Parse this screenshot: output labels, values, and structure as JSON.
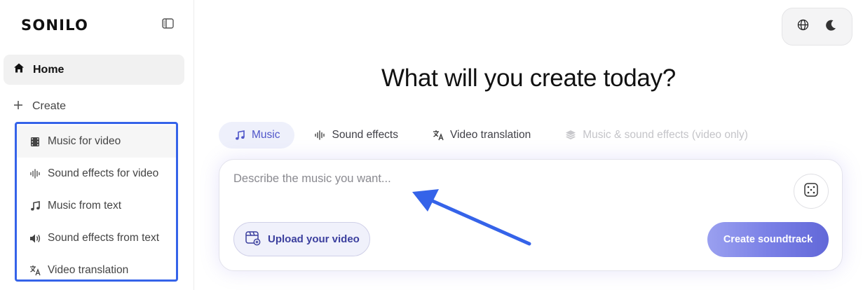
{
  "sidebar": {
    "logo": "SONILO",
    "home_label": "Home",
    "create_label": "Create",
    "create_items": [
      {
        "label": "Music for video",
        "icon": "film-icon"
      },
      {
        "label": "Sound effects for video",
        "icon": "waveform-icon"
      },
      {
        "label": "Music from text",
        "icon": "music-note-icon"
      },
      {
        "label": "Sound effects from text",
        "icon": "speaker-icon"
      },
      {
        "label": "Video translation",
        "icon": "translate-icon"
      }
    ]
  },
  "top_controls": {
    "language_icon": "globe-icon",
    "theme_icon": "moon-icon"
  },
  "main": {
    "heading": "What will you create today?",
    "tabs": [
      {
        "label": "Music",
        "icon": "music-note-icon",
        "state": "active"
      },
      {
        "label": "Sound effects",
        "icon": "waveform-icon",
        "state": "normal"
      },
      {
        "label": "Video translation",
        "icon": "translate-icon",
        "state": "normal"
      },
      {
        "label": "Music & sound effects (video only)",
        "icon": "layers-icon",
        "state": "disabled"
      }
    ],
    "prompt": {
      "placeholder": "Describe the music you want...",
      "value": ""
    },
    "upload_label": "Upload your video",
    "create_label": "Create soundtrack"
  },
  "colors": {
    "accent": "#4f55c9",
    "highlight_border": "#3563e9",
    "annotation_arrow": "#3563e9",
    "create_button_gradient": [
      "#9aa0f0",
      "#6268d8"
    ]
  }
}
